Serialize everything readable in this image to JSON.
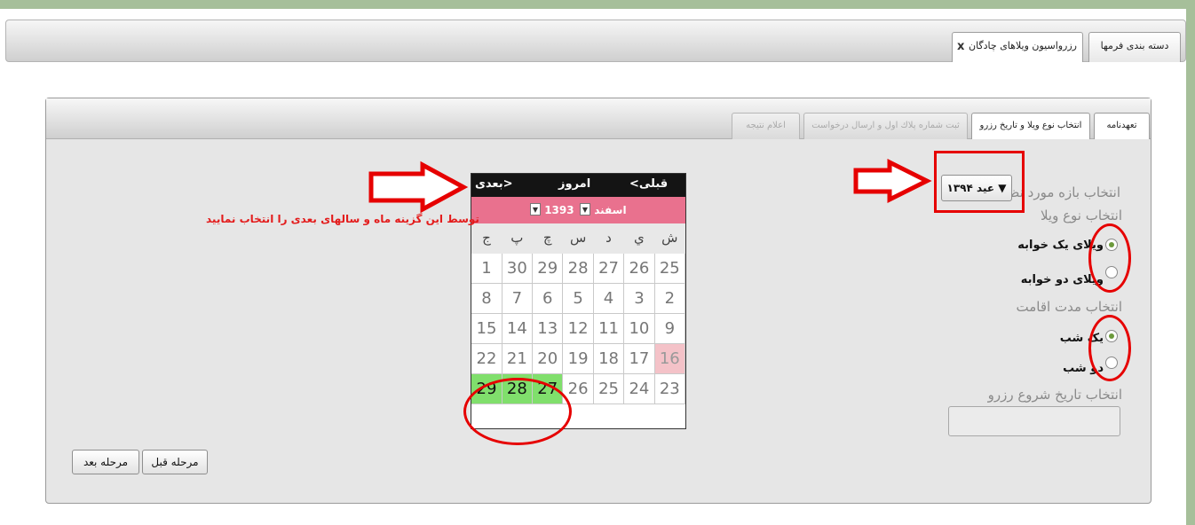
{
  "window_tabs": {
    "category_tab": "دسته بندی فرمها",
    "main_tab": "رزرواسیون ویلاهای چادگان",
    "close_glyph": "x"
  },
  "wizard_tabs": [
    {
      "label": "تعهدنامه",
      "state": "active"
    },
    {
      "label": "انتخاب نوع ویلا و تاریخ رزرو",
      "state": "active"
    },
    {
      "label": "ثبت شماره پلاك اول و ارسال درخواست",
      "state": "disabled"
    },
    {
      "label": "اعلام نتیجه",
      "state": "disabled"
    }
  ],
  "form": {
    "period_label": "انتخاب بازه مورد نظر",
    "period_value": "عید ۱۳۹۴ ▼",
    "villa_type_label": "انتخاب نوع ویلا",
    "villa_options": [
      {
        "label": "ویلای یک خوابه",
        "selected": true
      },
      {
        "label": "ویلای دو خوابه",
        "selected": false
      }
    ],
    "stay_label": "انتخاب مدت اقامت",
    "stay_options": [
      {
        "label": "یک شب",
        "selected": true
      },
      {
        "label": "دو شب",
        "selected": false
      }
    ],
    "start_date_label": "انتخاب تاریخ شروع رزرو",
    "start_date_value": ""
  },
  "calendar": {
    "nav_prev": "<قبلی",
    "nav_today": "امروز",
    "nav_next": "بعدی>",
    "month": "اسفند",
    "year": "1393",
    "weekdays": [
      "ش",
      "ي",
      "د",
      "س",
      "چ",
      "پ",
      "ج"
    ],
    "weeks": [
      [
        "25",
        "26",
        "27",
        "28",
        "29",
        "30",
        "1"
      ],
      [
        "2",
        "3",
        "4",
        "5",
        "6",
        "7",
        "8"
      ],
      [
        "9",
        "10",
        "11",
        "12",
        "13",
        "14",
        "15"
      ],
      [
        "16",
        "17",
        "18",
        "19",
        "20",
        "21",
        "22"
      ],
      [
        "23",
        "24",
        "25",
        "26",
        "27",
        "28",
        "29"
      ]
    ],
    "holiday_day": "16",
    "available_days": [
      "27",
      "28",
      "29"
    ]
  },
  "annotation": "توسط این گزینه ماه و سالهای بعدی را انتخاب نمایید",
  "buttons": {
    "prev_step": "مرحله قبل",
    "next_step": "مرحله بعد"
  },
  "colors": {
    "highlight_red": "#e60000",
    "calendar_header_pink": "#e9718e",
    "available_green": "#80df6c",
    "holiday_pink": "#f4c2c8",
    "frame_green": "#a6bf9a"
  }
}
